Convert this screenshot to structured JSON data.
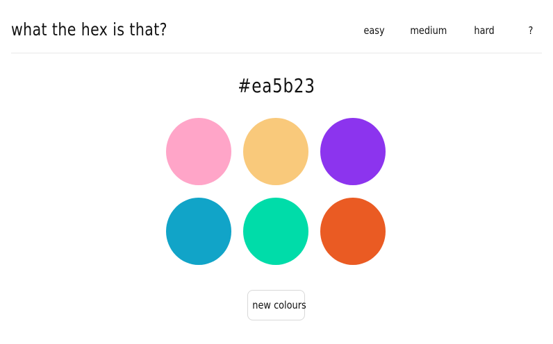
{
  "app": {
    "title": "what the hex is that?"
  },
  "nav": {
    "items": [
      {
        "label": "easy"
      },
      {
        "label": "medium"
      },
      {
        "label": "hard"
      },
      {
        "label": "?"
      }
    ]
  },
  "game": {
    "target_hex": "#ea5b23",
    "swatches": [
      {
        "color": "#ffa5c8"
      },
      {
        "color": "#f9c97b"
      },
      {
        "color": "#8c34ee"
      },
      {
        "color": "#11a4c8"
      },
      {
        "color": "#00dca9"
      },
      {
        "color": "#ea5b23"
      }
    ],
    "new_button_label": "new colours"
  }
}
